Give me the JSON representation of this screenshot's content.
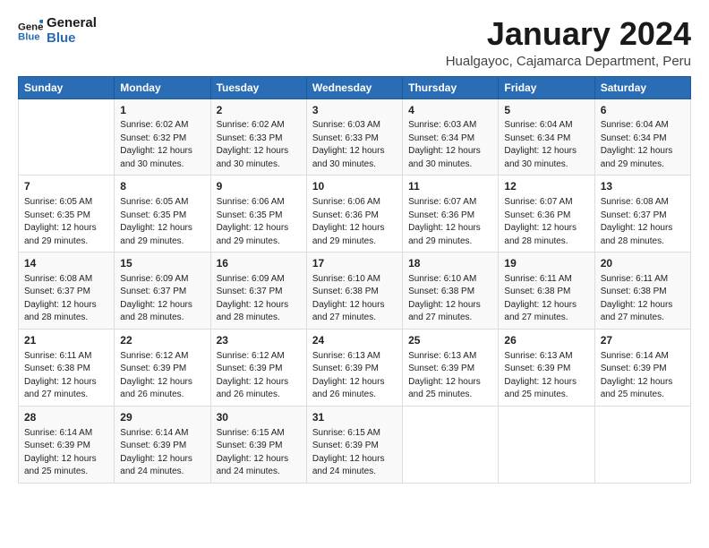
{
  "logo": {
    "line1": "General",
    "line2": "Blue"
  },
  "title": "January 2024",
  "subtitle": "Hualgayoc, Cajamarca Department, Peru",
  "headers": [
    "Sunday",
    "Monday",
    "Tuesday",
    "Wednesday",
    "Thursday",
    "Friday",
    "Saturday"
  ],
  "weeks": [
    [
      {
        "day": "",
        "info": ""
      },
      {
        "day": "1",
        "info": "Sunrise: 6:02 AM\nSunset: 6:32 PM\nDaylight: 12 hours\nand 30 minutes."
      },
      {
        "day": "2",
        "info": "Sunrise: 6:02 AM\nSunset: 6:33 PM\nDaylight: 12 hours\nand 30 minutes."
      },
      {
        "day": "3",
        "info": "Sunrise: 6:03 AM\nSunset: 6:33 PM\nDaylight: 12 hours\nand 30 minutes."
      },
      {
        "day": "4",
        "info": "Sunrise: 6:03 AM\nSunset: 6:34 PM\nDaylight: 12 hours\nand 30 minutes."
      },
      {
        "day": "5",
        "info": "Sunrise: 6:04 AM\nSunset: 6:34 PM\nDaylight: 12 hours\nand 30 minutes."
      },
      {
        "day": "6",
        "info": "Sunrise: 6:04 AM\nSunset: 6:34 PM\nDaylight: 12 hours\nand 29 minutes."
      }
    ],
    [
      {
        "day": "7",
        "info": "Sunrise: 6:05 AM\nSunset: 6:35 PM\nDaylight: 12 hours\nand 29 minutes."
      },
      {
        "day": "8",
        "info": "Sunrise: 6:05 AM\nSunset: 6:35 PM\nDaylight: 12 hours\nand 29 minutes."
      },
      {
        "day": "9",
        "info": "Sunrise: 6:06 AM\nSunset: 6:35 PM\nDaylight: 12 hours\nand 29 minutes."
      },
      {
        "day": "10",
        "info": "Sunrise: 6:06 AM\nSunset: 6:36 PM\nDaylight: 12 hours\nand 29 minutes."
      },
      {
        "day": "11",
        "info": "Sunrise: 6:07 AM\nSunset: 6:36 PM\nDaylight: 12 hours\nand 29 minutes."
      },
      {
        "day": "12",
        "info": "Sunrise: 6:07 AM\nSunset: 6:36 PM\nDaylight: 12 hours\nand 28 minutes."
      },
      {
        "day": "13",
        "info": "Sunrise: 6:08 AM\nSunset: 6:37 PM\nDaylight: 12 hours\nand 28 minutes."
      }
    ],
    [
      {
        "day": "14",
        "info": "Sunrise: 6:08 AM\nSunset: 6:37 PM\nDaylight: 12 hours\nand 28 minutes."
      },
      {
        "day": "15",
        "info": "Sunrise: 6:09 AM\nSunset: 6:37 PM\nDaylight: 12 hours\nand 28 minutes."
      },
      {
        "day": "16",
        "info": "Sunrise: 6:09 AM\nSunset: 6:37 PM\nDaylight: 12 hours\nand 28 minutes."
      },
      {
        "day": "17",
        "info": "Sunrise: 6:10 AM\nSunset: 6:38 PM\nDaylight: 12 hours\nand 27 minutes."
      },
      {
        "day": "18",
        "info": "Sunrise: 6:10 AM\nSunset: 6:38 PM\nDaylight: 12 hours\nand 27 minutes."
      },
      {
        "day": "19",
        "info": "Sunrise: 6:11 AM\nSunset: 6:38 PM\nDaylight: 12 hours\nand 27 minutes."
      },
      {
        "day": "20",
        "info": "Sunrise: 6:11 AM\nSunset: 6:38 PM\nDaylight: 12 hours\nand 27 minutes."
      }
    ],
    [
      {
        "day": "21",
        "info": "Sunrise: 6:11 AM\nSunset: 6:38 PM\nDaylight: 12 hours\nand 27 minutes."
      },
      {
        "day": "22",
        "info": "Sunrise: 6:12 AM\nSunset: 6:39 PM\nDaylight: 12 hours\nand 26 minutes."
      },
      {
        "day": "23",
        "info": "Sunrise: 6:12 AM\nSunset: 6:39 PM\nDaylight: 12 hours\nand 26 minutes."
      },
      {
        "day": "24",
        "info": "Sunrise: 6:13 AM\nSunset: 6:39 PM\nDaylight: 12 hours\nand 26 minutes."
      },
      {
        "day": "25",
        "info": "Sunrise: 6:13 AM\nSunset: 6:39 PM\nDaylight: 12 hours\nand 25 minutes."
      },
      {
        "day": "26",
        "info": "Sunrise: 6:13 AM\nSunset: 6:39 PM\nDaylight: 12 hours\nand 25 minutes."
      },
      {
        "day": "27",
        "info": "Sunrise: 6:14 AM\nSunset: 6:39 PM\nDaylight: 12 hours\nand 25 minutes."
      }
    ],
    [
      {
        "day": "28",
        "info": "Sunrise: 6:14 AM\nSunset: 6:39 PM\nDaylight: 12 hours\nand 25 minutes."
      },
      {
        "day": "29",
        "info": "Sunrise: 6:14 AM\nSunset: 6:39 PM\nDaylight: 12 hours\nand 24 minutes."
      },
      {
        "day": "30",
        "info": "Sunrise: 6:15 AM\nSunset: 6:39 PM\nDaylight: 12 hours\nand 24 minutes."
      },
      {
        "day": "31",
        "info": "Sunrise: 6:15 AM\nSunset: 6:39 PM\nDaylight: 12 hours\nand 24 minutes."
      },
      {
        "day": "",
        "info": ""
      },
      {
        "day": "",
        "info": ""
      },
      {
        "day": "",
        "info": ""
      }
    ]
  ],
  "accent_color": "#2a6db5"
}
